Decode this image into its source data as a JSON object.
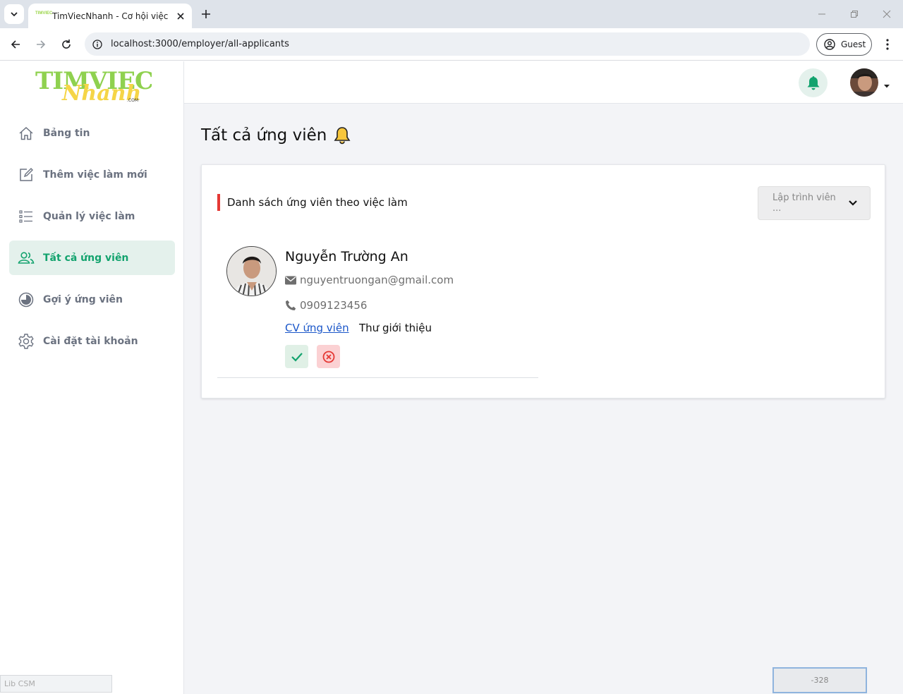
{
  "browser": {
    "tab_title": "TimViecNhanh - Cơ hội việc làm",
    "favicon_text": "TIMVIEC",
    "url": "localhost:3000/employer/all-applicants",
    "profile_label": "Guest"
  },
  "sidebar": {
    "logo_top": "TIMVIEC",
    "logo_script": "Nhanh",
    "logo_suffix": ".COM",
    "items": [
      {
        "label": "Bảng tin",
        "icon": "home-icon",
        "active": false
      },
      {
        "label": "Thêm việc làm mới",
        "icon": "edit-icon",
        "active": false
      },
      {
        "label": "Quản lý việc làm",
        "icon": "list-icon",
        "active": false
      },
      {
        "label": "Tất cả ứng viên",
        "icon": "users-icon",
        "active": true
      },
      {
        "label": "Gợi ý ứng viên",
        "icon": "pie-chart-icon",
        "active": false
      },
      {
        "label": "Cài đặt tài khoản",
        "icon": "settings-icon",
        "active": false
      }
    ],
    "footer_label": "Lib CSM"
  },
  "page": {
    "title": "Tất cả ứng viên",
    "section_title": "Danh sách ứng viên theo việc làm",
    "job_filter_value": "Lập trình viên ..."
  },
  "applicant": {
    "name": "Nguyễn Trường An",
    "email": "nguyentruongan@gmail.com",
    "phone": "0909123456",
    "cv_link": "CV ứng viên",
    "cover_letter": "Thư giới thiệu"
  },
  "counter": "-328",
  "colors": {
    "accent": "#13a36e",
    "active_bg": "#e4f1ec",
    "section_bar": "#e53935",
    "logo_green": "#8fd14f",
    "logo_yellow": "#f5d547"
  }
}
